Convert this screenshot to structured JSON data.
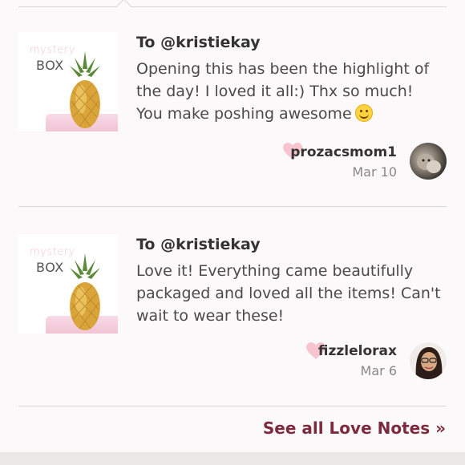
{
  "thumbnail": {
    "script_text": "mystery",
    "box_text": "BOX"
  },
  "notes": [
    {
      "to": "To @kristiekay",
      "message": "Opening this has been the highlight of the day! I loved it all:) Thx so much! You make poshing awesome",
      "has_emoji": true,
      "username": "prozacsmom1",
      "date": "Mar 10"
    },
    {
      "to": "To @kristiekay",
      "message": "Love it! Everything came beautifully packaged and loved all the items! Can't wait to wear these!",
      "has_emoji": false,
      "username": "fizzlelorax",
      "date": "Mar 6"
    }
  ],
  "footer": {
    "see_all_label": "See all Love Notes »"
  },
  "colors": {
    "accent": "#7d2a3e",
    "heart": "#f7c4cf",
    "background": "#fbf9fa"
  }
}
